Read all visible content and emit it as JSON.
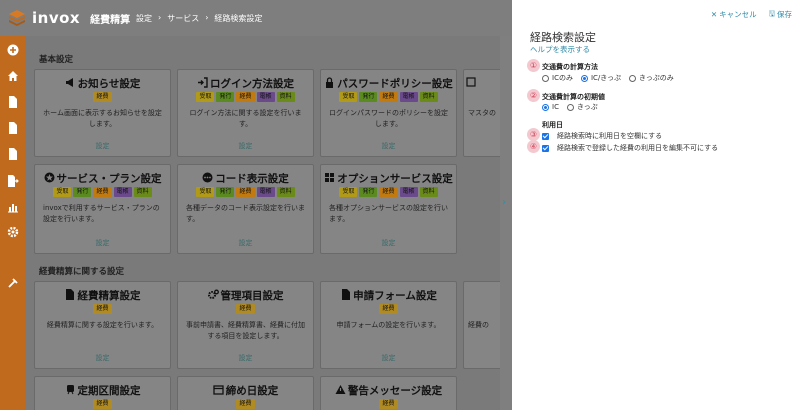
{
  "header": {
    "logo_text": "invox",
    "logo_sub": "経費精算",
    "breadcrumb": [
      "設定",
      "サービス",
      "経路検索設定"
    ]
  },
  "sidebar": {
    "icons": [
      "plus-circle-icon",
      "home-icon",
      "document-icon",
      "document-icon",
      "document-icon",
      "export-icon",
      "chart-icon",
      "gear-icon",
      "tools-icon"
    ]
  },
  "sections": {
    "basic": "基本設定",
    "keihi": "経費精算に関する設定"
  },
  "cards": {
    "notice": {
      "title": "お知らせ設定",
      "tags": [
        "経費"
      ],
      "desc": "ホーム画面に表示するお知らせを設定します。",
      "link": "設定"
    },
    "login": {
      "title": "ログイン方法設定",
      "tags": [
        "受取",
        "発行",
        "経費",
        "電帳",
        "資料"
      ],
      "desc": "ログイン方法に関する設定を行います。",
      "link": "設定"
    },
    "password": {
      "title": "パスワードポリシー設定",
      "tags": [
        "受取",
        "発行",
        "経費",
        "電帳",
        "資料"
      ],
      "desc": "ログインパスワードのポリシーを設定します。",
      "link": "設定"
    },
    "master": {
      "desc": "マスタの"
    },
    "plan": {
      "title": "サービス・プラン設定",
      "tags": [
        "受取",
        "発行",
        "経費",
        "電帳",
        "資料"
      ],
      "desc": "invoxで利用するサービス・プランの設定を行います。",
      "link": "設定"
    },
    "code": {
      "title": "コード表示設定",
      "tags": [
        "受取",
        "発行",
        "経費",
        "電帳",
        "資料"
      ],
      "desc": "各種データのコード表示設定を行います。",
      "link": "設定"
    },
    "option": {
      "title": "オプションサービス設定",
      "tags": [
        "受取",
        "発行",
        "経費",
        "電帳",
        "資料"
      ],
      "desc": "各種オプションサービスの設定を行います。",
      "link": "設定"
    },
    "keihiset": {
      "title": "経費精算設定",
      "tags": [
        "経費"
      ],
      "desc": "経費精算に関する設定を行います。",
      "link": "設定"
    },
    "kanri": {
      "title": "管理項目設定",
      "tags": [
        "経費"
      ],
      "desc": "事前申請書、経費精算書、経費に付加する項目を設定します。",
      "link": "設定"
    },
    "form": {
      "title": "申請フォーム設定",
      "tags": [
        "経費"
      ],
      "desc": "申請フォームの設定を行います。",
      "link": "設定"
    },
    "keihi4": {
      "desc": "経費の"
    },
    "teiki": {
      "title": "定期区間設定",
      "tags": [
        "経費"
      ]
    },
    "shime": {
      "title": "締め日設定",
      "tags": [
        "経費"
      ]
    },
    "keikoku": {
      "title": "警告メッセージ設定",
      "tags": [
        "経費"
      ]
    }
  },
  "panel": {
    "cancel": "キャンセル",
    "save": "保存",
    "title": "経路検索設定",
    "help": "ヘルプを表示する",
    "q1": {
      "num": "①",
      "label": "交通費の計算方法",
      "options": [
        "ICのみ",
        "IC/きっぷ",
        "きっぷのみ"
      ],
      "selected": 1
    },
    "q2": {
      "num": "②",
      "label": "交通費計算の初期値",
      "options": [
        "IC",
        "きっぷ"
      ],
      "selected": 0
    },
    "q3": {
      "group": "利用日",
      "num3": "③",
      "check1": "経路検索時に利用日を空欄にする",
      "num4": "④",
      "check2": "経路検索で登録した経費の利用日を編集不可にする"
    }
  },
  "colors": {
    "accent": "#2f8aa8",
    "sidebar": "#bf6a1d",
    "number_badge": "#d0445a"
  }
}
